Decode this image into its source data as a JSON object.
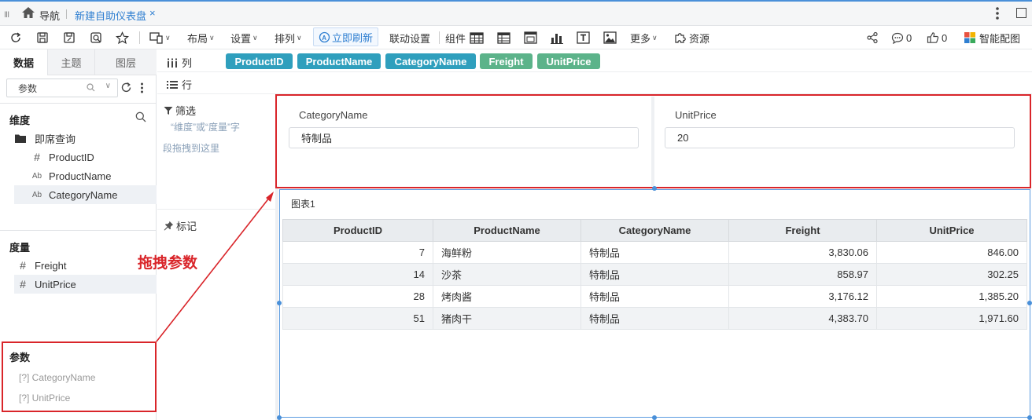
{
  "tabbar": {
    "nav_label": "导航",
    "tab_label": "新建自助仪表盘",
    "close_glyph": "×"
  },
  "toolbar": {
    "layout": "布局",
    "settings": "设置",
    "arrange": "排列",
    "refresh": "立即刷新",
    "linkage": "联动设置",
    "component": "组件",
    "more": "更多",
    "resources": "资源",
    "comments_count": "0",
    "likes_count": "0",
    "smart_color": "智能配图"
  },
  "left_panel": {
    "tabs": [
      "数据",
      "主题",
      "图层"
    ],
    "select_value": "参数",
    "dimension_header": "维度",
    "dimension_folder": "即席查询",
    "dimension_fields": [
      {
        "icon": "#",
        "name": "ProductID"
      },
      {
        "icon": "Ab",
        "name": "ProductName"
      },
      {
        "icon": "Ab",
        "name": "CategoryName"
      }
    ],
    "measure_header": "度量",
    "measure_fields": [
      {
        "icon": "#",
        "name": "Freight"
      },
      {
        "icon": "#",
        "name": "UnitPrice"
      }
    ],
    "param_header": "参数",
    "params": [
      "[?] CategoryName",
      "[?] UnitPrice"
    ]
  },
  "shelves": {
    "columns_label": "列",
    "rows_label": "行",
    "filter_label": "筛选",
    "filter_hint_1": "“维度”或“度量”字",
    "filter_hint_2": "段拖拽到这里",
    "mark_label": "标记",
    "column_pills": [
      {
        "name": "ProductID",
        "kind": "dimension"
      },
      {
        "name": "ProductName",
        "kind": "dimension"
      },
      {
        "name": "CategoryName",
        "kind": "dimension"
      },
      {
        "name": "Freight",
        "kind": "measure"
      },
      {
        "name": "UnitPrice",
        "kind": "measure"
      }
    ]
  },
  "filters": [
    {
      "label": "CategoryName",
      "value": "特制品"
    },
    {
      "label": "UnitPrice",
      "value": "20"
    }
  ],
  "chart": {
    "title": "图表1",
    "columns": [
      "ProductID",
      "ProductName",
      "CategoryName",
      "Freight",
      "UnitPrice"
    ],
    "rows": [
      [
        "7",
        "海鲜粉",
        "特制品",
        "3,830.06",
        "846.00"
      ],
      [
        "14",
        "沙茶",
        "特制品",
        "858.97",
        "302.25"
      ],
      [
        "28",
        "烤肉酱",
        "特制品",
        "3,176.12",
        "1,385.20"
      ],
      [
        "51",
        "猪肉干",
        "特制品",
        "4,383.70",
        "1,971.60"
      ]
    ]
  },
  "annotation": {
    "text": "拖拽参数"
  },
  "colors": {
    "accent": "#2f7fd1",
    "dimension_pill": "#2f9fbd",
    "measure_pill": "#5cb38a",
    "annotation": "#d9252a"
  }
}
